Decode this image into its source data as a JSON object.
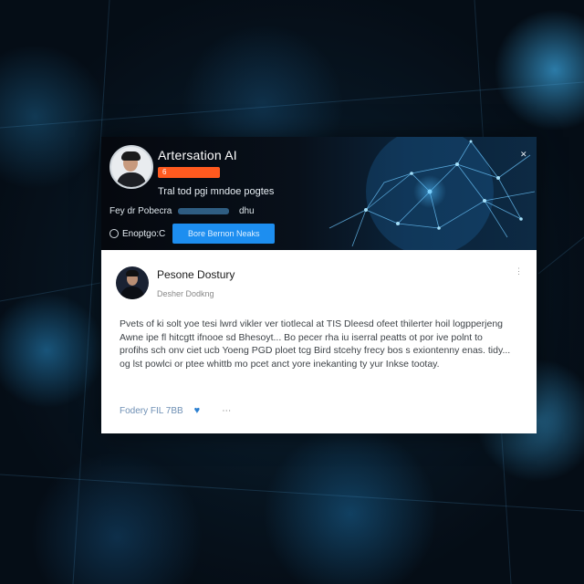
{
  "profile": {
    "name": "Artersation AI",
    "badge_icon": "6",
    "tagline": "Tral tod pgi mndoe pogtes",
    "meta_prefix": "Fey dr Pobecra",
    "meta_suffix": "dhu",
    "following_label": "Enoptgo:C",
    "follow_button": "Bore Bernon Neaks",
    "close_symbol": "✕",
    "colors": {
      "badge": "#ff5a1f",
      "button": "#1d8ef0"
    }
  },
  "post": {
    "author": "Pesone Dostury",
    "handle": "Desher Dodkng",
    "menu_symbol": "⋮",
    "body": "Pvets of ki solt yoe tesi lwrd vikler ver tiotlecal at TIS Dleesd ofeet thilerter hoil logpperjeng Awne ipe fl hitcgtt ifnooe sd Bhesoyt... Bo pecer rha iu iserral peatts ot por ive polnt to profihs sch onv ciet ucb Yoeng PGD ploet tcg Bird stcehy frecy bos s exiontenny enas. tidy... og lst powlci or ptee whittb mo pcet anct yore inekanting ty yur Inkse tootay.",
    "footer_meta": "Fodery FIL 7BB",
    "footer_more": "⋯",
    "heart_icon": "♥"
  }
}
